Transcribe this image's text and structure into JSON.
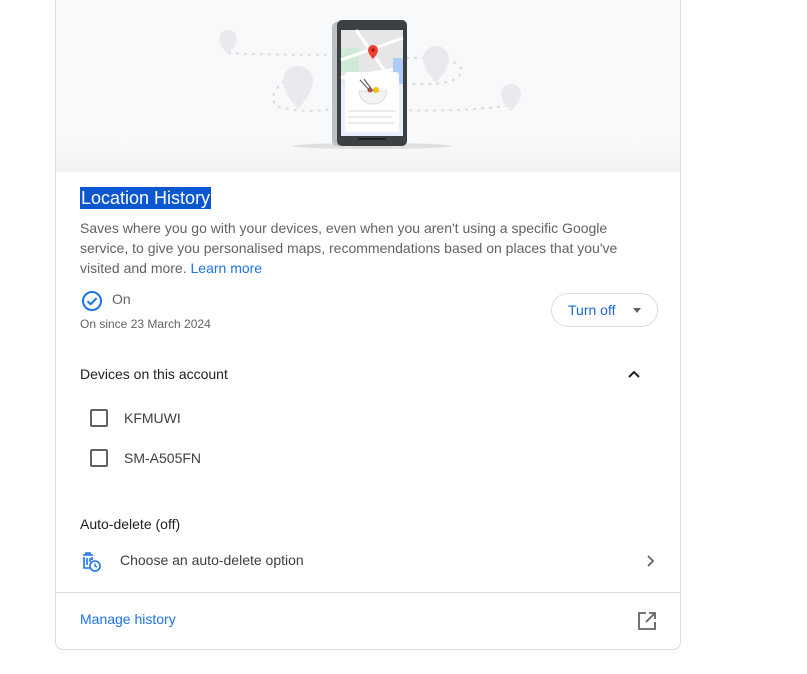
{
  "card": {
    "title": "Location History",
    "description": "Saves where you go with your devices, even when you aren't using a specific Google service, to give you personalised maps, recommendations based on places that you've visited and more.",
    "learn_more": "Learn more",
    "status": "On",
    "since": "On since 23 March 2024",
    "turn_off_label": "Turn off"
  },
  "devices": {
    "title": "Devices on this account",
    "items": [
      {
        "label": "KFMUWI",
        "checked": false
      },
      {
        "label": "SM-A505FN",
        "checked": false
      }
    ]
  },
  "auto_delete": {
    "title": "Auto-delete (off)",
    "option_label": "Choose an auto-delete option"
  },
  "footer": {
    "manage_label": "Manage history"
  },
  "colors": {
    "accent": "#1a73e8",
    "selection": "#0b57d0",
    "border": "#dadce0",
    "text": "#3c4043"
  },
  "icons": {
    "status": "check-circle-icon",
    "expand": "chevron-up-icon",
    "auto_delete": "trash-clock-icon",
    "open": "chevron-right-icon",
    "external": "open-in-new-icon"
  }
}
